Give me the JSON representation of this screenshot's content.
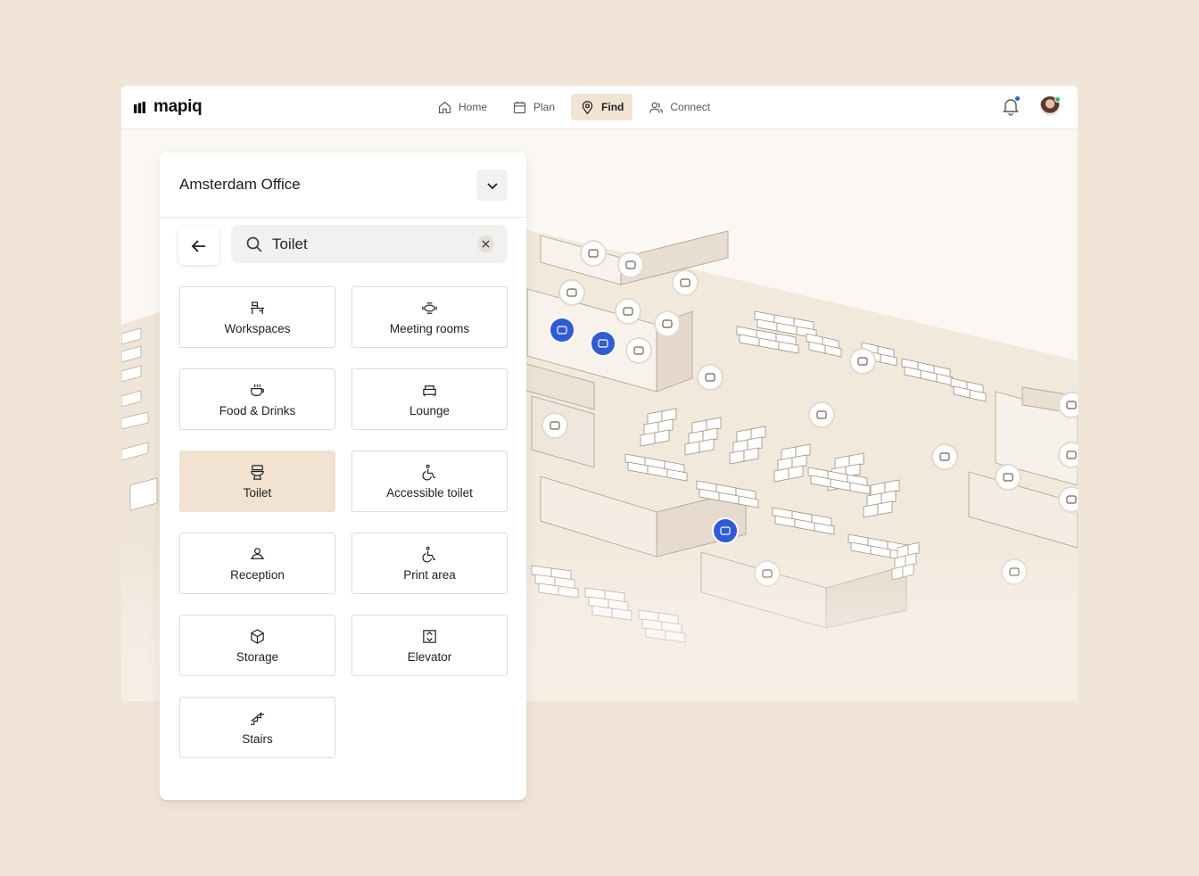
{
  "app": {
    "logo_text": "mapiq"
  },
  "nav": {
    "items": [
      {
        "label": "Home",
        "icon": "home-icon",
        "active": false
      },
      {
        "label": "Plan",
        "icon": "calendar-icon",
        "active": false
      },
      {
        "label": "Find",
        "icon": "location-pin-icon",
        "active": true
      },
      {
        "label": "Connect",
        "icon": "people-icon",
        "active": false
      }
    ]
  },
  "header_right": {
    "notification_icon": "bell-icon",
    "avatar_icon": "user-avatar"
  },
  "panel": {
    "office_name": "Amsterdam Office",
    "search": {
      "value": "Toilet",
      "placeholder": "Search"
    },
    "categories": [
      {
        "label": "Workspaces",
        "icon": "desk-icon",
        "selected": false
      },
      {
        "label": "Meeting rooms",
        "icon": "meeting-table-icon",
        "selected": false
      },
      {
        "label": "Food & Drinks",
        "icon": "coffee-cup-icon",
        "selected": false
      },
      {
        "label": "Lounge",
        "icon": "armchair-icon",
        "selected": false
      },
      {
        "label": "Toilet",
        "icon": "toilet-icon",
        "selected": true
      },
      {
        "label": "Accessible toilet",
        "icon": "wheelchair-icon",
        "selected": false
      },
      {
        "label": "Reception",
        "icon": "reception-person-icon",
        "selected": false
      },
      {
        "label": "Print area",
        "icon": "wheelchair-icon",
        "selected": false
      },
      {
        "label": "Storage",
        "icon": "box-icon",
        "selected": false
      },
      {
        "label": "Elevator",
        "icon": "elevator-icon",
        "selected": false
      },
      {
        "label": "Stairs",
        "icon": "stairs-icon",
        "selected": false
      }
    ]
  },
  "colors": {
    "page_background": "#f1e5d8",
    "selected_tile": "#f1e2d1",
    "active_nav": "#f1e4d4",
    "map_pin_highlight": "#2f5bd6"
  }
}
